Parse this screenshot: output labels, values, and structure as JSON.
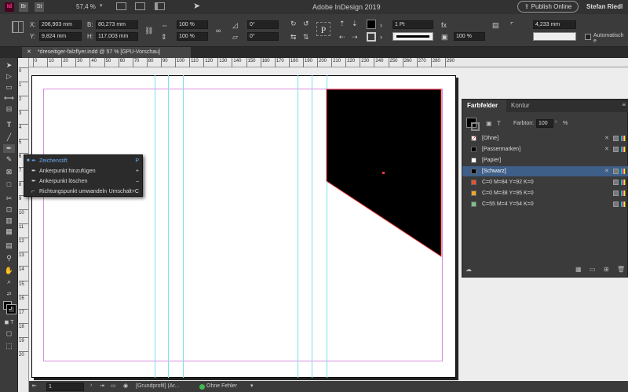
{
  "menubar": {
    "logo": "Id",
    "br_label": "Br",
    "st_label": "St",
    "zoom": "57,4 %",
    "app_title": "Adobe InDesign 2019",
    "publish_label": "Publish Online",
    "user_name": "Stefan Riedl"
  },
  "control": {
    "x_label": "X:",
    "x_value": "206,903 mm",
    "y_label": "Y:",
    "y_value": "9,824 mm",
    "w_label": "B:",
    "w_value": "80,273 mm",
    "h_label": "H:",
    "h_value": "117,003 mm",
    "scale_x": "100 %",
    "scale_y": "100 %",
    "angle": "0°",
    "shear": "0°",
    "stroke_weight": "1 Pt",
    "opacity": "100 %",
    "size_value": "4,233 mm",
    "auto_label": "Automatisch e"
  },
  "document": {
    "tab_label": "*dreseitiger-falzflyer.indd @ 57 % [GPU-Vorschau]"
  },
  "ruler": {
    "h_ticks": [
      "0",
      "10",
      "20",
      "30",
      "40",
      "50",
      "60",
      "70",
      "80",
      "90",
      "100",
      "110",
      "120",
      "130",
      "140",
      "150",
      "160",
      "170",
      "180",
      "190",
      "200",
      "210",
      "220",
      "230",
      "240",
      "250",
      "260",
      "270",
      "280",
      "290"
    ],
    "v_ticks": [
      "0",
      "1",
      "2",
      "3",
      "4",
      "5",
      "6",
      "7",
      "8",
      "9",
      "10",
      "11",
      "12",
      "13",
      "14",
      "15",
      "16",
      "17",
      "18",
      "19",
      "20"
    ]
  },
  "flyout": {
    "items": [
      {
        "label": "Zeichenstift",
        "shortcut": "P"
      },
      {
        "label": "Ankerpunkt hinzufügen",
        "shortcut": "+"
      },
      {
        "label": "Ankerpunkt löschen",
        "shortcut": "–"
      },
      {
        "label": "Richtungspunkt umwandeln",
        "shortcut": "Umschalt+C"
      }
    ]
  },
  "swatches_panel": {
    "tab_active": "Farbfelder",
    "tab_inactive": "Kontur",
    "tint_label": "Farbton:",
    "tint_value": "100",
    "tint_unit": "%",
    "items": [
      {
        "label": "[Ohne]",
        "color": "none"
      },
      {
        "label": "[Passermarken]",
        "color": "#000000"
      },
      {
        "label": "[Papier]",
        "color": "#ffffff"
      },
      {
        "label": "[Schwarz]",
        "color": "#000000"
      },
      {
        "label": "C=0 M=84 Y=92 K=0",
        "color": "#e8522e"
      },
      {
        "label": "C=0 M=38 Y=95 K=0",
        "color": "#f5a623"
      },
      {
        "label": "C=55 M=4 Y=54 K=0",
        "color": "#7cc08a"
      }
    ],
    "selected_index": 3
  },
  "statusbar": {
    "page": "1",
    "profile": "[Grundprofil] (Ar...",
    "status": "Ohne Fehler"
  },
  "colors": {
    "selection": "#3e5f88",
    "guide": "#7de0ea",
    "margin": "#d98ee0",
    "status_ok": "#3fb950"
  }
}
